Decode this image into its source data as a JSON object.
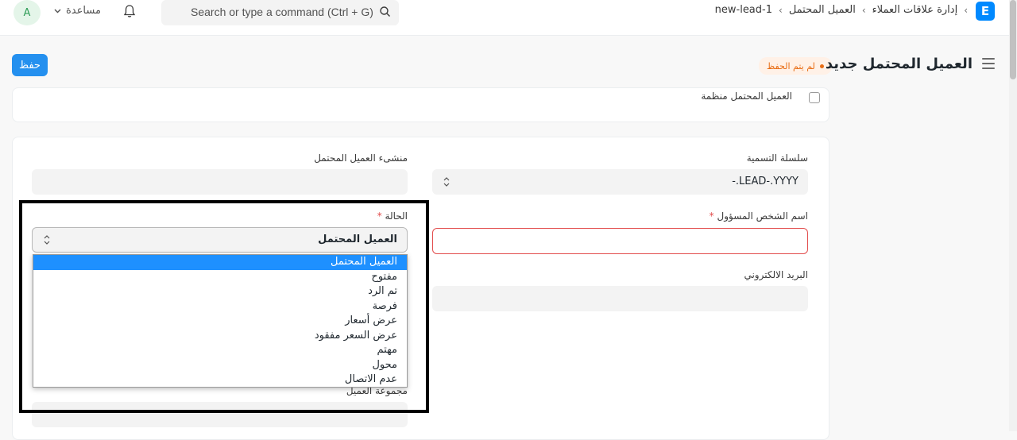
{
  "navbar": {
    "avatar_letter": "A",
    "help_label": "مساعدة",
    "search_placeholder": "Search or type a command (Ctrl + G)",
    "breadcrumbs": [
      "إدارة علاقات العملاء",
      "العميل المحتمل",
      "new-lead-1"
    ],
    "logo_letter": "E"
  },
  "page_header": {
    "title": "العميل المحتمل جديد",
    "status_indicator": "لم يتم الحفظ",
    "save_label": "حفظ"
  },
  "section_top": {
    "checkbox_label": "العميل المحتمل منظمة"
  },
  "form": {
    "naming_series": {
      "label": "سلسلة التسمية",
      "value": "-.LEAD-.YYYY"
    },
    "lead_owner": {
      "label": "منشىء العميل المحتمل",
      "value": ""
    },
    "person_name": {
      "label": "اسم الشخص المسؤول",
      "required_mark": "*",
      "value": ""
    },
    "status": {
      "label": "الحالة",
      "required_mark": "*",
      "value": "العميل المحتمل",
      "options": [
        "العميل المحتمل",
        "مفتوح",
        "تم الرد",
        "فرصة",
        "عرض أسعار",
        "عرض السعر مفقود",
        "مهتم",
        "محول",
        "عدم الاتصال"
      ]
    },
    "email": {
      "label": "البريد الالكتروني",
      "value": ""
    },
    "customer_group": {
      "label": "مجموعة العميل",
      "value": ""
    }
  },
  "colors": {
    "primary": "#2490ef",
    "selected_option": "#1e90ff",
    "error": "#e24c4c",
    "indicator": "#e86c13"
  }
}
